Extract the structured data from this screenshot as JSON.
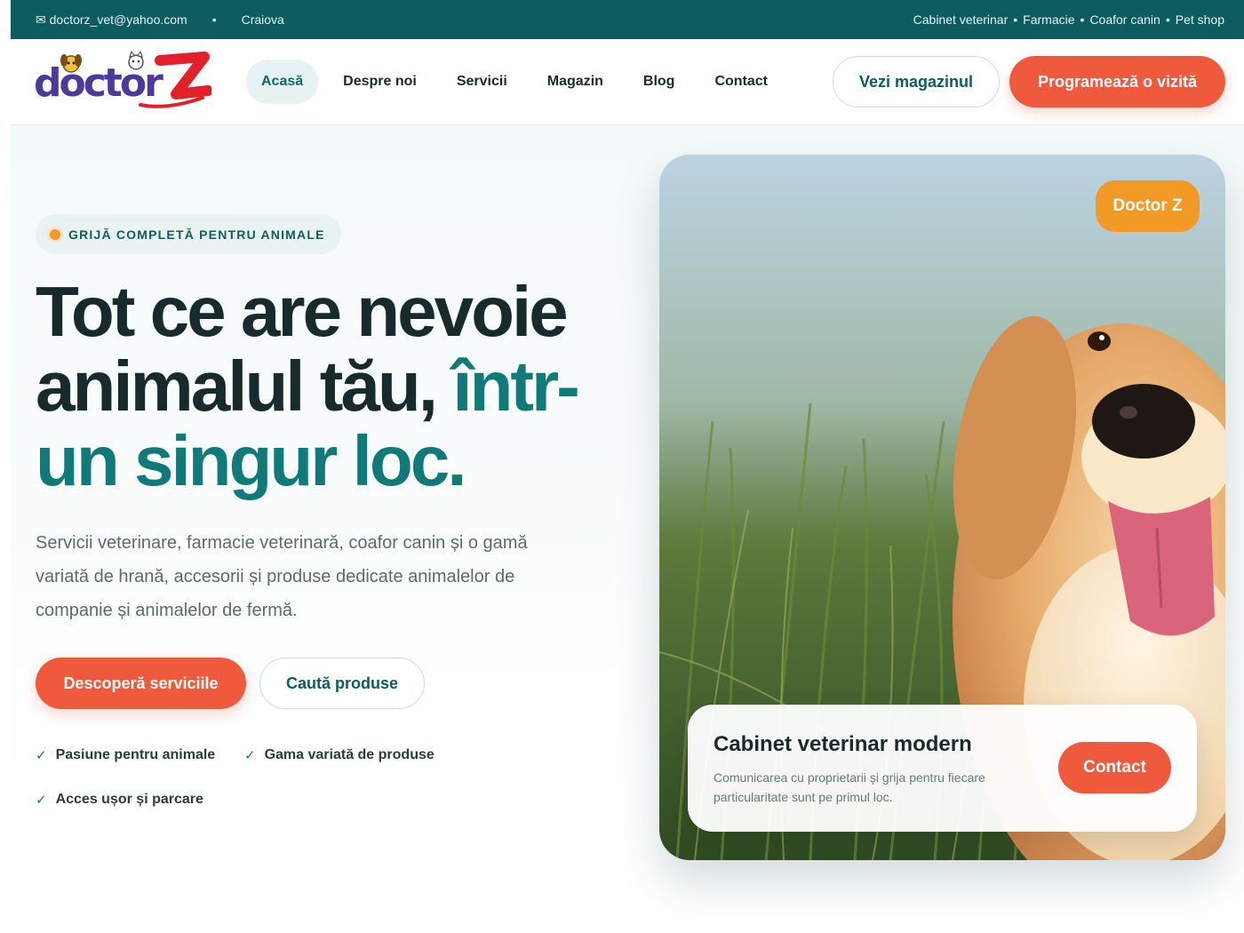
{
  "topbar": {
    "email": "✉ doctorz_vet@yahoo.com",
    "dot": "•",
    "city": "Craiova",
    "services": [
      "Cabinet veterinar",
      "Farmacie",
      "Coafor canin",
      "Pet shop"
    ],
    "separator": "•"
  },
  "header": {
    "logo_alt": "doctorZ",
    "nav": [
      "Acasă",
      "Despre noi",
      "Servicii",
      "Magazin",
      "Blog",
      "Contact"
    ],
    "shop_button": "Vezi magazinul",
    "cta_button": "Programează o vizită"
  },
  "hero": {
    "badge": "GRIJĂ COMPLETĂ PENTRU ANIMALE",
    "title_part1": "Tot ce are nevoie animalul tău, ",
    "title_accent": "într-un singur loc.",
    "lead": "Servicii veterinare, farmacie veterinară, coafor canin și o gamă variată de hrană, accesorii și produse dedicate animalelor de companie și animalelor de fermă.",
    "primary_button": "Descoperă serviciile",
    "secondary_button": "Caută produse",
    "features": [
      "Pasiune pentru animale",
      "Gama variată de produse",
      "Acces ușor și parcare"
    ],
    "check": "✓"
  },
  "card": {
    "brand_pill": "Doctor Z",
    "info_title": "Cabinet veterinar modern",
    "info_desc": "Comunicarea cu proprietarii și grija pentru fiecare particularitate sunt pe primul loc.",
    "info_button": "Contact"
  },
  "colors": {
    "teal_dark": "#0d5c5f",
    "teal_accent": "#0f7a78",
    "coral": "#ef5a3c",
    "orange": "#f39a26"
  }
}
